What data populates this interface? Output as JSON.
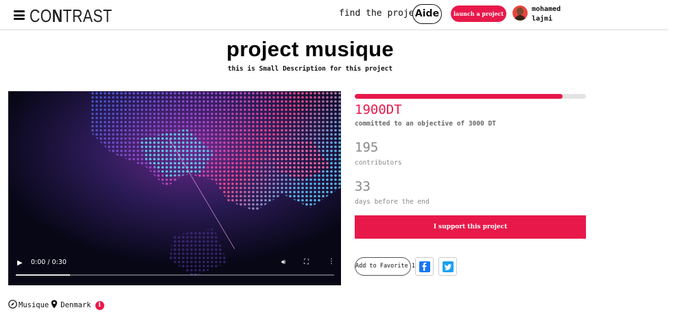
{
  "header": {
    "logo_left": "CO",
    "logo_bold": "N",
    "logo_right": "TRAST",
    "find_projects_label": "find the projects",
    "aide_label": "Aide",
    "launch_label": "launch a project",
    "user_name_first": "mohamed",
    "user_name_last": "lajmi"
  },
  "project": {
    "title": "project musique",
    "description": "this is Small Description for this project",
    "category": "Musique",
    "location": "Denmark"
  },
  "video": {
    "time": "0:00 / 0:30",
    "buffered_fraction": 0.17
  },
  "funding": {
    "progress_fraction": 0.9,
    "amount": "1900DT",
    "objective_text": "committed to an objective of 3000 DT",
    "contributors_count": "195",
    "contributors_label": "contributors",
    "days_count": "33",
    "days_label": "days before the end",
    "support_label": "I support this project",
    "favorite_label": "Add to Favorite 1"
  },
  "colors": {
    "accent": "#e8194a",
    "facebook": "#1877f2",
    "twitter": "#1da1f2"
  },
  "icons": [
    "menu-icon",
    "compass-icon",
    "map-pin-icon",
    "info-icon",
    "facebook-icon",
    "twitter-icon",
    "play-icon",
    "volume-icon",
    "fullscreen-icon",
    "more-options-icon"
  ]
}
